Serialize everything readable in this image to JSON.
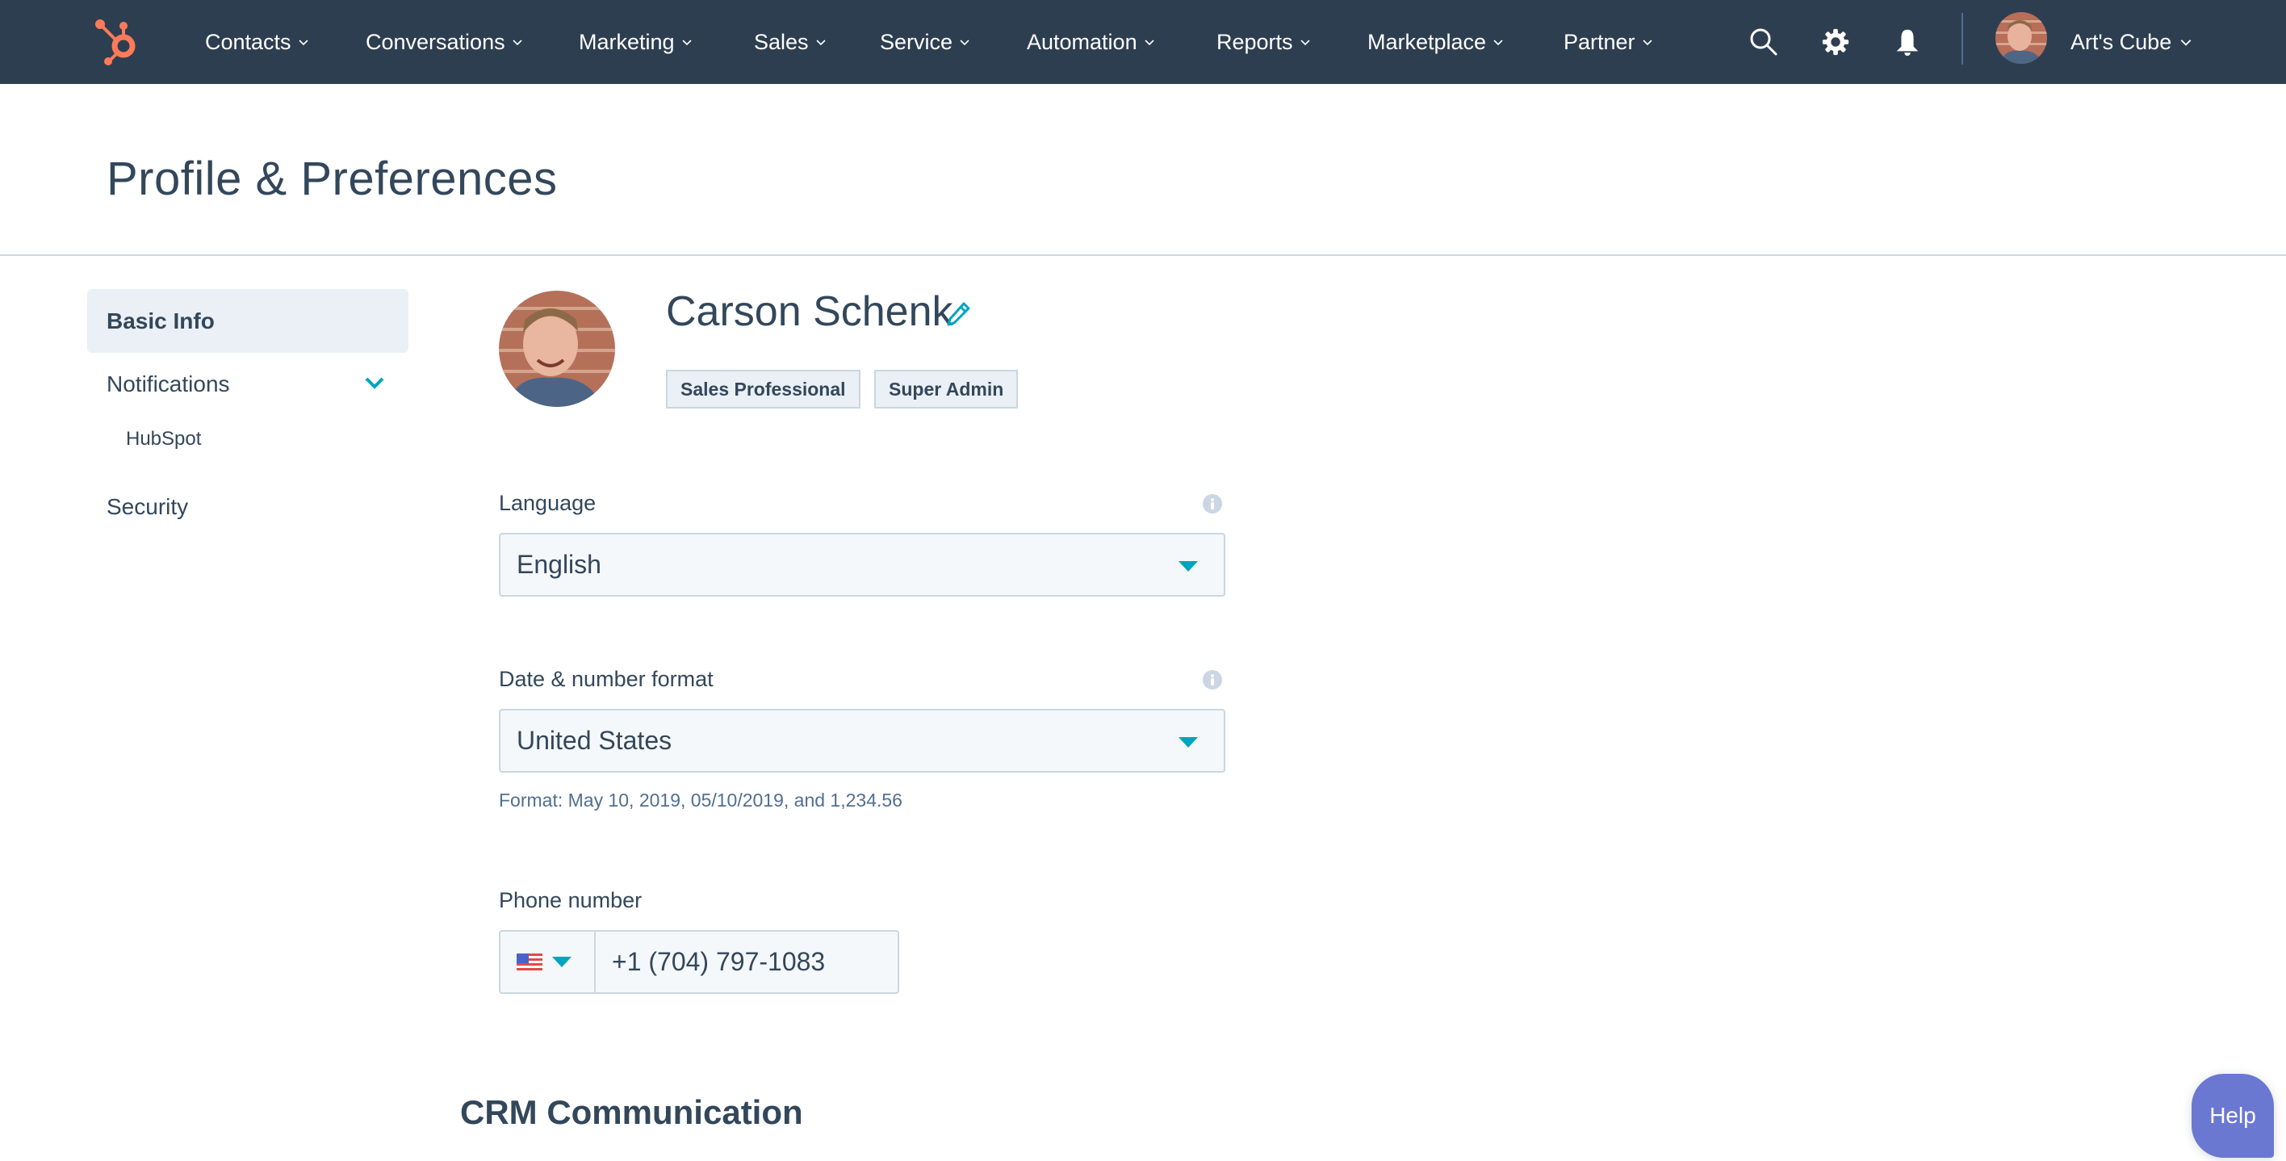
{
  "nav": {
    "logo": "hubspot-sprocket-logo",
    "items": [
      {
        "label": "Contacts"
      },
      {
        "label": "Conversations"
      },
      {
        "label": "Marketing"
      },
      {
        "label": "Sales"
      },
      {
        "label": "Service"
      },
      {
        "label": "Automation"
      },
      {
        "label": "Reports"
      },
      {
        "label": "Marketplace"
      },
      {
        "label": "Partner"
      }
    ],
    "icons": [
      "search-icon",
      "gear-icon",
      "bell-icon"
    ],
    "account_name": "Art's Cube"
  },
  "header": {
    "title": "Profile & Preferences"
  },
  "sidebar": {
    "items": [
      {
        "label": "Basic Info",
        "active": true
      },
      {
        "label": "Notifications",
        "expanded": true
      },
      {
        "label": "HubSpot",
        "sub": true
      },
      {
        "label": "Security"
      }
    ]
  },
  "profile": {
    "name": "Carson Schenk",
    "badges": [
      "Sales Professional",
      "Super Admin"
    ]
  },
  "fields": {
    "language": {
      "label": "Language",
      "value": "English"
    },
    "date_format": {
      "label": "Date & number format",
      "value": "United States",
      "help": "Format: May 10, 2019, 05/10/2019, and 1,234.56"
    },
    "phone": {
      "label": "Phone number",
      "country": "US",
      "value": "+1 (704) 797-1083"
    }
  },
  "sections": {
    "crm": "CRM Communication"
  },
  "help_button": {
    "label": "Help"
  },
  "colors": {
    "nav_bg": "#2d3e50",
    "accent": "#00a4bd",
    "logo": "#ff7a59",
    "help": "#6a78d1"
  }
}
